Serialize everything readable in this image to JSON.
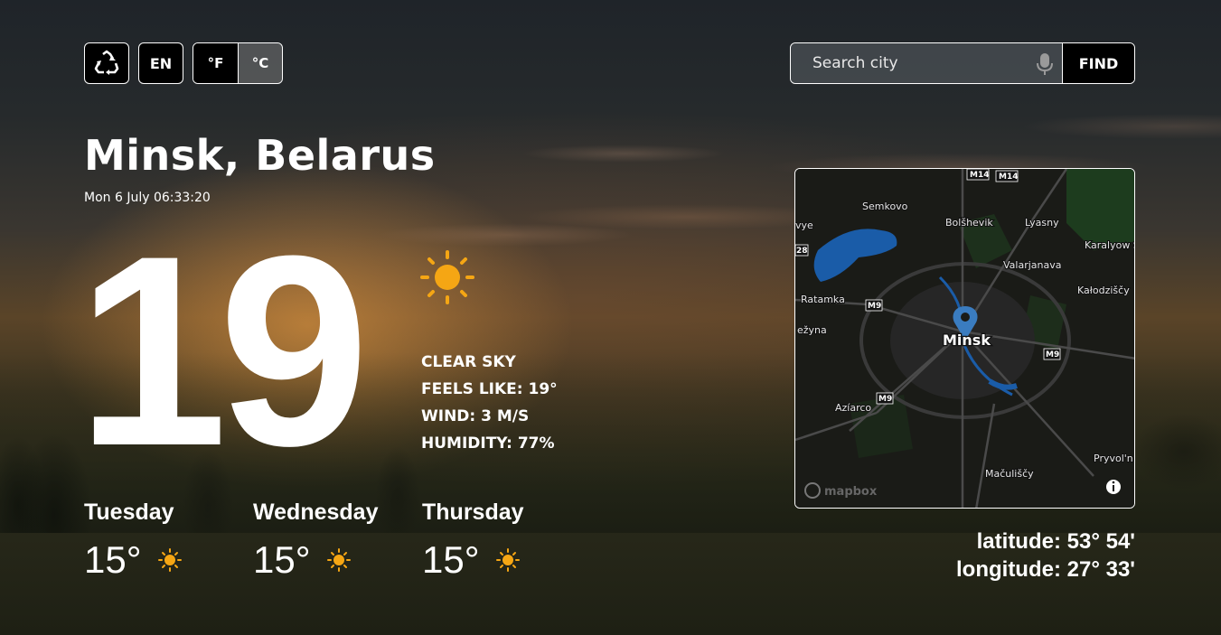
{
  "controls": {
    "language": "EN",
    "unit_f": "°F",
    "unit_c": "°C",
    "active_unit": "°C"
  },
  "search": {
    "placeholder": "Search city",
    "button_label": "FIND"
  },
  "location": {
    "city": "Minsk, Belarus",
    "datetime": "Mon 6 July 06:33:20"
  },
  "current": {
    "temperature": "19",
    "icon": "sun-icon",
    "condition": "CLEAR SKY",
    "feels_like": "FEELS LIKE: 19°",
    "wind": "WIND: 3 M/S",
    "humidity": "HUMIDITY: 77%"
  },
  "forecast": [
    {
      "day": "Tuesday",
      "temp": "15°",
      "icon": "sun-icon"
    },
    {
      "day": "Wednesday",
      "temp": "15°",
      "icon": "sun-icon"
    },
    {
      "day": "Thursday",
      "temp": "15°",
      "icon": "sun-icon"
    }
  ],
  "map": {
    "center_label": "Minsk",
    "labels": [
      "Semkovo",
      "Bolšhevik",
      "Lyasny",
      "Karalyow S",
      "Valarjanava",
      "Kałodziščy",
      "Ratamka",
      "ežyna",
      "Azíarco",
      "Mačuliščy",
      "Pryvol'n",
      "vye"
    ],
    "road_shields": [
      "M14",
      "M14",
      "M9",
      "M9",
      "M9",
      "28"
    ],
    "attribution": "mapbox"
  },
  "coordinates": {
    "latitude": "latitude: 53° 54'",
    "longitude": "longitude: 27° 33'"
  },
  "colors": {
    "accent_sun": "#f5a614",
    "map_pin": "#3a7cc0",
    "map_water": "#1a5ca8"
  }
}
